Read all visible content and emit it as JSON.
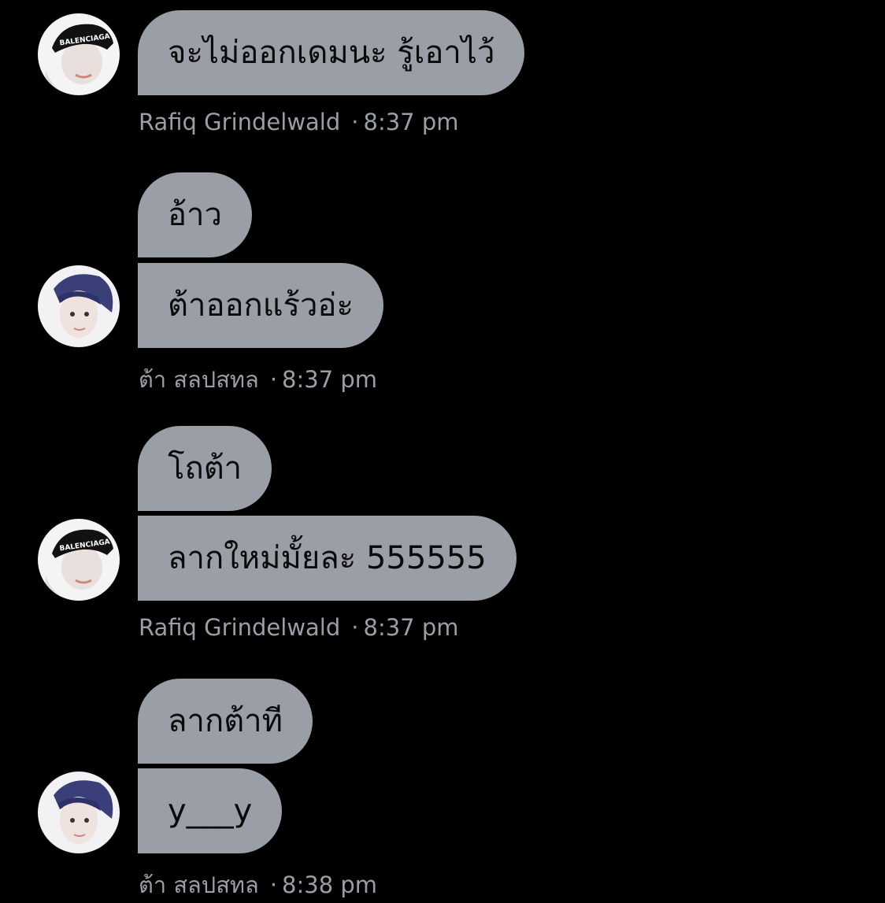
{
  "messages": [
    {
      "sender": "Rafiq Grindelwald",
      "time": "8:37 pm",
      "avatar_icon": "avatar-cap-icon",
      "avatar_cap_text": "BALENCIAGA",
      "bubbles": [
        "จะไม่ออกเดมนะ รู้เอาไว้"
      ]
    },
    {
      "sender": "ต้า สลปสทล",
      "time": "8:37 pm",
      "avatar_icon": "avatar-portrait-icon",
      "bubbles": [
        "อ้าว",
        "ต้าออกแร้วอ่ะ"
      ]
    },
    {
      "sender": "Rafiq Grindelwald",
      "time": "8:37 pm",
      "avatar_icon": "avatar-cap-icon",
      "avatar_cap_text": "BALENCIAGA",
      "bubbles": [
        "โถต้า",
        "ลากใหม่มั้ยละ 555555"
      ]
    },
    {
      "sender": "ต้า สลปสทล",
      "time": "8:38 pm",
      "avatar_icon": "avatar-portrait-icon",
      "bubbles": [
        "ลากต้าที",
        "y___y"
      ]
    }
  ],
  "separator": "·",
  "colors": {
    "background": "#000000",
    "bubble": "#9a9ea6",
    "bubble_text": "#0a0a0a",
    "meta_text": "#9a9ea6"
  }
}
